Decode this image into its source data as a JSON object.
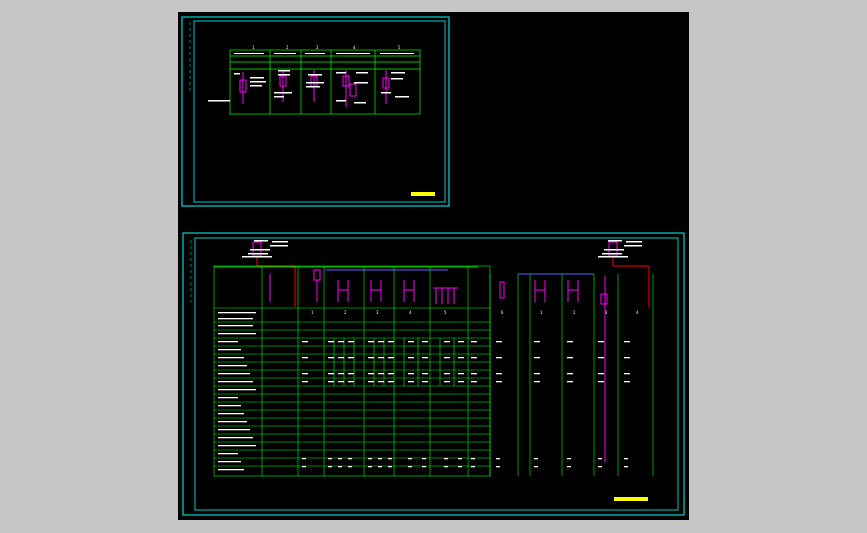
{
  "colors": {
    "canvas_bg": "#c6c6c6",
    "viewport_bg": "#000000",
    "frame_cyan": "#00ffff",
    "table_green": "#00ff00",
    "symbol_magenta": "#ff00ff",
    "text_white": "#ffffff",
    "label_yellow": "#ffff00",
    "wire_red": "#ff0000",
    "bus_blue": "#4a6bff"
  },
  "sheet1": {
    "title_block": "",
    "columns": [
      {
        "num": "1",
        "header": "",
        "device": ""
      },
      {
        "num": "2",
        "header": "",
        "device": ""
      },
      {
        "num": "3",
        "header": "",
        "device": ""
      },
      {
        "num": "4",
        "header": "",
        "device": ""
      },
      {
        "num": "5",
        "header": "",
        "device": ""
      }
    ]
  },
  "sheet2": {
    "title_block": "",
    "bus_label": "",
    "panels": [
      {
        "num": "1",
        "code": ""
      },
      {
        "num": "2",
        "code": ""
      },
      {
        "num": "3",
        "code": ""
      },
      {
        "num": "4",
        "code": ""
      },
      {
        "num": "5",
        "code": ""
      },
      {
        "num": "6",
        "code": ""
      },
      {
        "num": "1",
        "code": ""
      },
      {
        "num": "2",
        "code": ""
      },
      {
        "num": "3",
        "code": ""
      },
      {
        "num": "4",
        "code": ""
      }
    ]
  }
}
